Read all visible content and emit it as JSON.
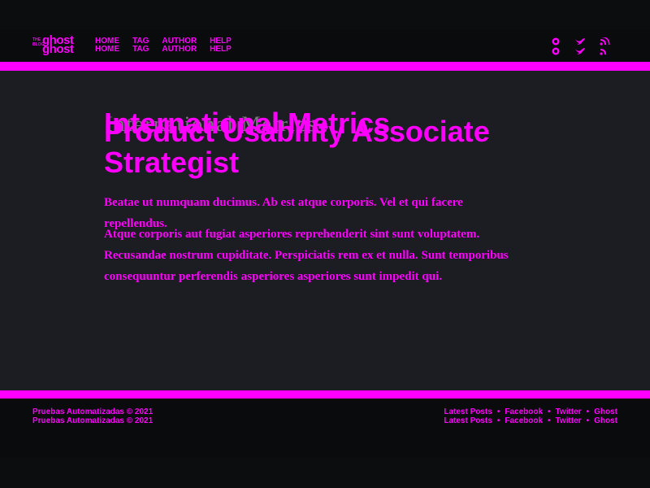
{
  "brand": {
    "logo_small": "THE BLOG",
    "logo_big": "ghost",
    "accent": "#ff00ff"
  },
  "nav": [
    {
      "label": "HOME"
    },
    {
      "label": "TAG"
    },
    {
      "label": "AUTHOR"
    },
    {
      "label": "HELP"
    }
  ],
  "social": [
    {
      "icon": "ghost-icon"
    },
    {
      "icon": "twitter-icon"
    },
    {
      "icon": "rss-icon"
    }
  ],
  "post": {
    "title_a": "International Metrics",
    "title_b": "Product Usability Associate Strategist",
    "excerpt": "Beatae ut numquam ducimus. Ab est atque corporis. Vel et qui facere repellendus.",
    "body": "Atque corporis aut fugiat asperiores reprehenderit sint sunt voluptatem. Recusandae nostrum cupiditate. Perspiciatis rem ex et nulla. Sunt temporibus consequuntur perferendis asperiores asperiores sunt impedit qui."
  },
  "footer": {
    "copyright": "Pruebas Automatizadas © 2021",
    "links": [
      "Latest Posts",
      "Facebook",
      "Twitter",
      "Ghost"
    ]
  }
}
